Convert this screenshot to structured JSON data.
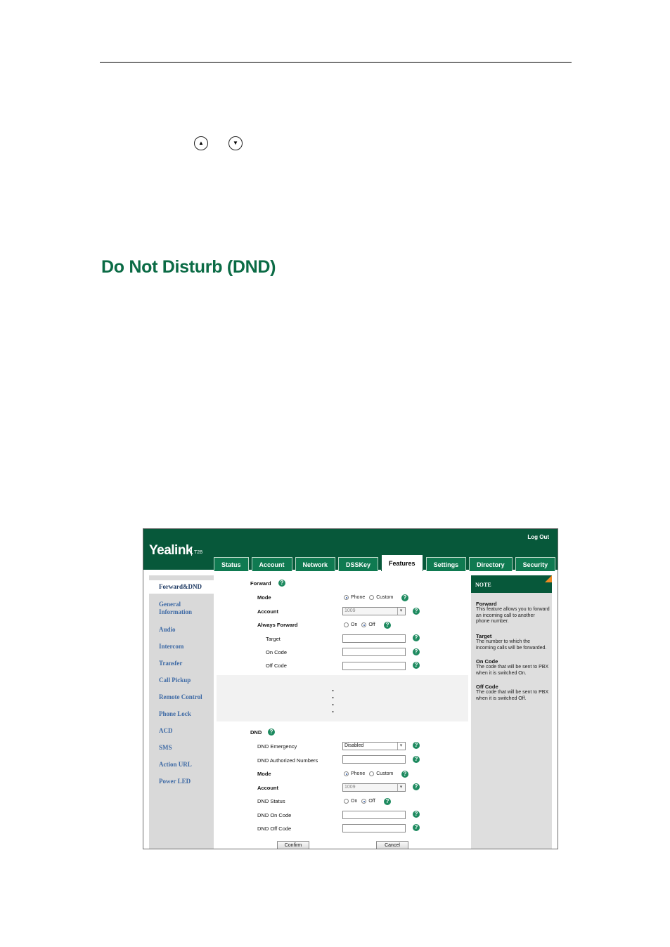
{
  "document": {
    "heading": "Do Not Disturb (DND)",
    "nav_up_icon": "up-arrow-key-icon",
    "nav_down_icon": "down-arrow-key-icon"
  },
  "webui": {
    "logo": "Yealink",
    "model": "T28",
    "logout": "Log Out",
    "tabs": [
      "Status",
      "Account",
      "Network",
      "DSSKey",
      "Features",
      "Settings",
      "Directory",
      "Security"
    ],
    "active_tab": "Features",
    "sidebar": [
      "Forward&DND",
      "General Information",
      "Audio",
      "Intercom",
      "Transfer",
      "Call Pickup",
      "Remote Control",
      "Phone Lock",
      "ACD",
      "SMS",
      "Action URL",
      "Power LED"
    ],
    "forward": {
      "title": "Forward",
      "mode_label": "Mode",
      "mode_options": [
        "Phone",
        "Custom"
      ],
      "mode_selected": "Phone",
      "account_label": "Account",
      "account_value": "1009",
      "always_label": "Always Forward",
      "onoff_options": [
        "On",
        "Off"
      ],
      "always_selected": "Off",
      "target_label": "Target",
      "target_value": "",
      "on_code_label": "On Code",
      "on_code_value": "",
      "off_code_label": "Off Code",
      "off_code_value": ""
    },
    "ellipsis": "⋮",
    "dnd": {
      "title": "DND",
      "emergency_label": "DND Emergency",
      "emergency_value": "Disabled",
      "authorized_label": "DND Authorized Numbers",
      "authorized_value": "",
      "mode_label": "Mode",
      "mode_options": [
        "Phone",
        "Custom"
      ],
      "mode_selected": "Phone",
      "account_label": "Account",
      "account_value": "1009",
      "status_label": "DND Status",
      "status_options": [
        "On",
        "Off"
      ],
      "status_selected": "Off",
      "on_code_label": "DND On Code",
      "on_code_value": "",
      "off_code_label": "DND Off Code",
      "off_code_value": ""
    },
    "buttons": {
      "confirm": "Confirm",
      "cancel": "Cancel"
    },
    "note": {
      "header": "NOTE",
      "items": [
        {
          "title": "Forward",
          "text": "This feature allows you to forward an incoming call to another phone number."
        },
        {
          "title": "Target",
          "text": "The number to which the incoming calls will be forwarded."
        },
        {
          "title": "On Code",
          "text": "The code that will be sent to PBX when it is switched On."
        },
        {
          "title": "Off Code",
          "text": "The code that will be sent to PBX when it is switched Off."
        }
      ]
    }
  }
}
